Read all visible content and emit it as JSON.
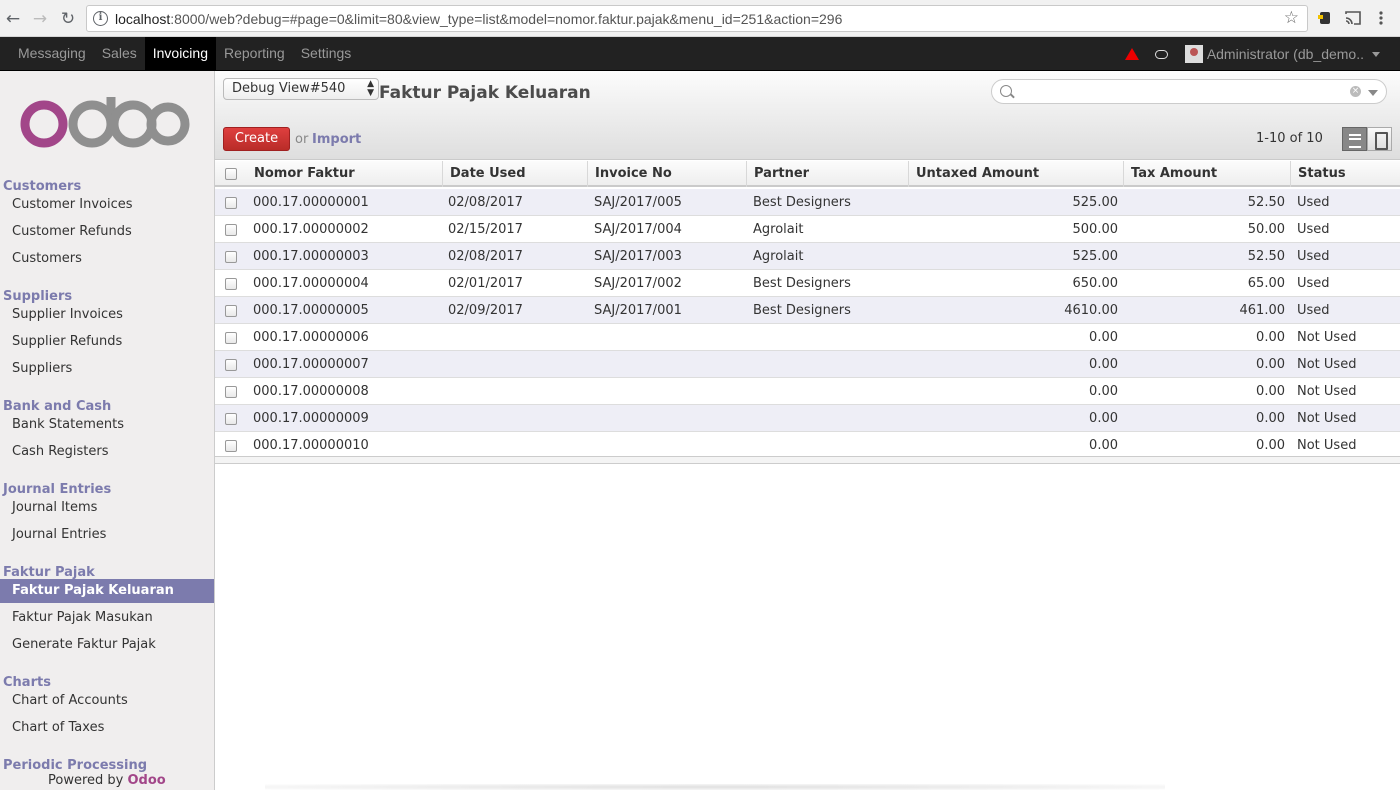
{
  "browser": {
    "url_host": "localhost",
    "url_rest": ":8000/web?debug=#page=0&limit=80&view_type=list&model=nomor.faktur.pajak&menu_id=251&action=296"
  },
  "topmenu": {
    "items": [
      {
        "label": "Messaging"
      },
      {
        "label": "Sales"
      },
      {
        "label": "Invoicing"
      },
      {
        "label": "Reporting"
      },
      {
        "label": "Settings"
      }
    ],
    "active": "Invoicing",
    "user": "Administrator (db_demo.."
  },
  "sidebar": {
    "sections": [
      {
        "title": "Customers",
        "items": [
          "Customer Invoices",
          "Customer Refunds",
          "Customers"
        ]
      },
      {
        "title": "Suppliers",
        "items": [
          "Supplier Invoices",
          "Supplier Refunds",
          "Suppliers"
        ]
      },
      {
        "title": "Bank and Cash",
        "items": [
          "Bank Statements",
          "Cash Registers"
        ]
      },
      {
        "title": "Journal Entries",
        "items": [
          "Journal Items",
          "Journal Entries"
        ]
      },
      {
        "title": "Faktur Pajak",
        "items": [
          "Faktur Pajak Keluaran",
          "Faktur Pajak Masukan",
          "Generate Faktur Pajak"
        ]
      },
      {
        "title": "Charts",
        "items": [
          "Chart of Accounts",
          "Chart of Taxes"
        ]
      },
      {
        "title": "Periodic Processing",
        "items": []
      }
    ],
    "active_item": "Faktur Pajak Keluaran",
    "powered_prefix": "Powered by ",
    "powered_brand": "Odoo"
  },
  "header": {
    "debug_view": "Debug View#540",
    "title": "Faktur Pajak Keluaran",
    "create_label": "Create",
    "or_label": "or",
    "import_label": "Import",
    "pager": "1-10 of 10"
  },
  "table": {
    "columns": [
      "Nomor Faktur",
      "Date Used",
      "Invoice No",
      "Partner",
      "Untaxed Amount",
      "Tax Amount",
      "Status"
    ],
    "rows": [
      [
        "000.17.00000001",
        "02/08/2017",
        "SAJ/2017/005",
        "Best Designers",
        "525.00",
        "52.50",
        "Used"
      ],
      [
        "000.17.00000002",
        "02/15/2017",
        "SAJ/2017/004",
        "Agrolait",
        "500.00",
        "50.00",
        "Used"
      ],
      [
        "000.17.00000003",
        "02/08/2017",
        "SAJ/2017/003",
        "Agrolait",
        "525.00",
        "52.50",
        "Used"
      ],
      [
        "000.17.00000004",
        "02/01/2017",
        "SAJ/2017/002",
        "Best Designers",
        "650.00",
        "65.00",
        "Used"
      ],
      [
        "000.17.00000005",
        "02/09/2017",
        "SAJ/2017/001",
        "Best Designers",
        "4610.00",
        "461.00",
        "Used"
      ],
      [
        "000.17.00000006",
        "",
        "",
        "",
        "0.00",
        "0.00",
        "Not Used"
      ],
      [
        "000.17.00000007",
        "",
        "",
        "",
        "0.00",
        "0.00",
        "Not Used"
      ],
      [
        "000.17.00000008",
        "",
        "",
        "",
        "0.00",
        "0.00",
        "Not Used"
      ],
      [
        "000.17.00000009",
        "",
        "",
        "",
        "0.00",
        "0.00",
        "Not Used"
      ],
      [
        "000.17.00000010",
        "",
        "",
        "",
        "0.00",
        "0.00",
        "Not Used"
      ]
    ]
  },
  "colors": {
    "accent": "#7c7bad",
    "brand": "#a24689",
    "create": "#d9534f"
  }
}
